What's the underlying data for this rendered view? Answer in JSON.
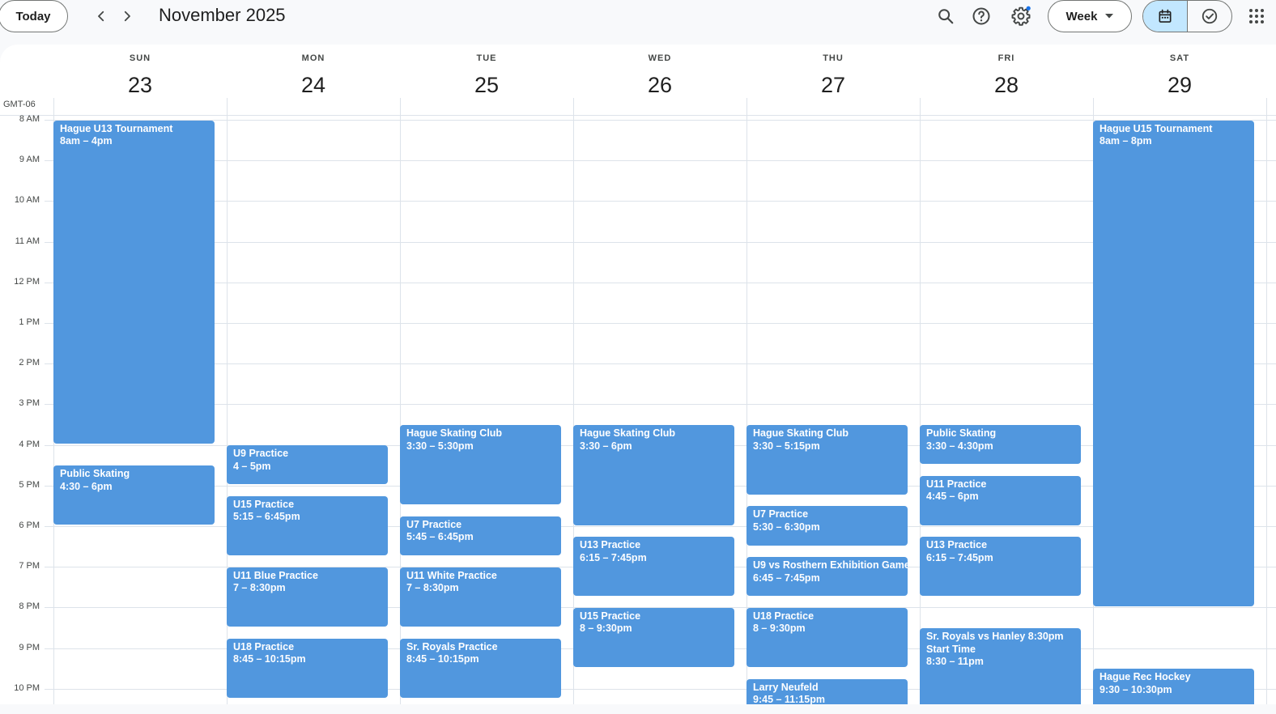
{
  "toolbar": {
    "today_label": "Today",
    "title": "November 2025",
    "view_label": "Week"
  },
  "icons": {
    "prev": "chevron-left-icon",
    "next": "chevron-right-icon",
    "search": "search-icon",
    "help": "help-icon",
    "settings": "gear-icon",
    "dropdown": "caret-down-icon",
    "calendar_view": "calendar-icon",
    "tasks_view": "check-circle-icon",
    "apps": "apps-grid-icon"
  },
  "colors": {
    "event": "#5197de",
    "active_segment": "#c2e7ff",
    "notification_dot": "#1a73e8"
  },
  "timezone": "GMT-06",
  "days": [
    {
      "dow": "SUN",
      "date": "23"
    },
    {
      "dow": "MON",
      "date": "24"
    },
    {
      "dow": "TUE",
      "date": "25"
    },
    {
      "dow": "WED",
      "date": "26"
    },
    {
      "dow": "THU",
      "date": "27"
    },
    {
      "dow": "FRI",
      "date": "28"
    },
    {
      "dow": "SAT",
      "date": "29"
    }
  ],
  "hours": [
    "8 AM",
    "9 AM",
    "10 AM",
    "11 AM",
    "12 PM",
    "1 PM",
    "2 PM",
    "3 PM",
    "4 PM",
    "5 PM",
    "6 PM",
    "7 PM",
    "8 PM",
    "9 PM",
    "10 PM"
  ],
  "events": [
    {
      "day": 0,
      "start": 8,
      "end": 16,
      "title": "Hague U13 Tournament",
      "time": "8am – 4pm"
    },
    {
      "day": 0,
      "start": 16.5,
      "end": 18,
      "title": "Public Skating",
      "time": "4:30 – 6pm"
    },
    {
      "day": 1,
      "start": 16,
      "end": 17,
      "title": "U9 Practice",
      "time": "4 – 5pm"
    },
    {
      "day": 1,
      "start": 17.25,
      "end": 18.75,
      "title": "U15 Practice",
      "time": "5:15 – 6:45pm"
    },
    {
      "day": 1,
      "start": 19,
      "end": 20.5,
      "title": "U11 Blue Practice",
      "time": "7 – 8:30pm"
    },
    {
      "day": 1,
      "start": 20.75,
      "end": 22.25,
      "title": "U18 Practice",
      "time": "8:45 – 10:15pm"
    },
    {
      "day": 2,
      "start": 15.5,
      "end": 17.5,
      "title": "Hague Skating Club",
      "time": "3:30 – 5:30pm"
    },
    {
      "day": 2,
      "start": 17.75,
      "end": 18.75,
      "title": "U7 Practice",
      "time": "5:45 – 6:45pm"
    },
    {
      "day": 2,
      "start": 19,
      "end": 20.5,
      "title": "U11 White Practice",
      "time": "7 – 8:30pm"
    },
    {
      "day": 2,
      "start": 20.75,
      "end": 22.25,
      "title": "Sr. Royals Practice",
      "time": "8:45 – 10:15pm"
    },
    {
      "day": 3,
      "start": 15.5,
      "end": 18,
      "title": "Hague Skating Club",
      "time": "3:30 – 6pm"
    },
    {
      "day": 3,
      "start": 18.25,
      "end": 19.75,
      "title": "U13 Practice",
      "time": "6:15 – 7:45pm"
    },
    {
      "day": 3,
      "start": 20,
      "end": 21.5,
      "title": "U15 Practice",
      "time": "8 – 9:30pm"
    },
    {
      "day": 4,
      "start": 15.5,
      "end": 17.25,
      "title": "Hague Skating Club",
      "time": "3:30 – 5:15pm"
    },
    {
      "day": 4,
      "start": 17.5,
      "end": 18.5,
      "title": "U7 Practice",
      "time": "5:30 – 6:30pm"
    },
    {
      "day": 4,
      "start": 18.75,
      "end": 19.75,
      "title": "U9 vs Rosthern Exhibition Game",
      "time": "6:45 – 7:45pm"
    },
    {
      "day": 4,
      "start": 20,
      "end": 21.5,
      "title": "U18 Practice",
      "time": "8 – 9:30pm"
    },
    {
      "day": 4,
      "start": 21.75,
      "end": 23.25,
      "title": "Larry Neufeld",
      "time": "9:45 – 11:15pm"
    },
    {
      "day": 5,
      "start": 15.5,
      "end": 16.5,
      "title": "Public Skating",
      "time": "3:30 – 4:30pm"
    },
    {
      "day": 5,
      "start": 16.75,
      "end": 18,
      "title": "U11 Practice",
      "time": "4:45 – 6pm"
    },
    {
      "day": 5,
      "start": 18.25,
      "end": 19.75,
      "title": "U13 Practice",
      "time": "6:15 – 7:45pm"
    },
    {
      "day": 5,
      "start": 20.5,
      "end": 23,
      "title": "Sr. Royals vs Hanley 8:30pm Start Time",
      "time": "8:30 – 11pm",
      "wrap": true
    },
    {
      "day": 6,
      "start": 8,
      "end": 20,
      "title": "Hague U15 Tournament",
      "time": "8am – 8pm"
    },
    {
      "day": 6,
      "start": 21.5,
      "end": 22.5,
      "title": "Hague Rec Hockey",
      "time": "9:30 – 10:30pm"
    }
  ]
}
